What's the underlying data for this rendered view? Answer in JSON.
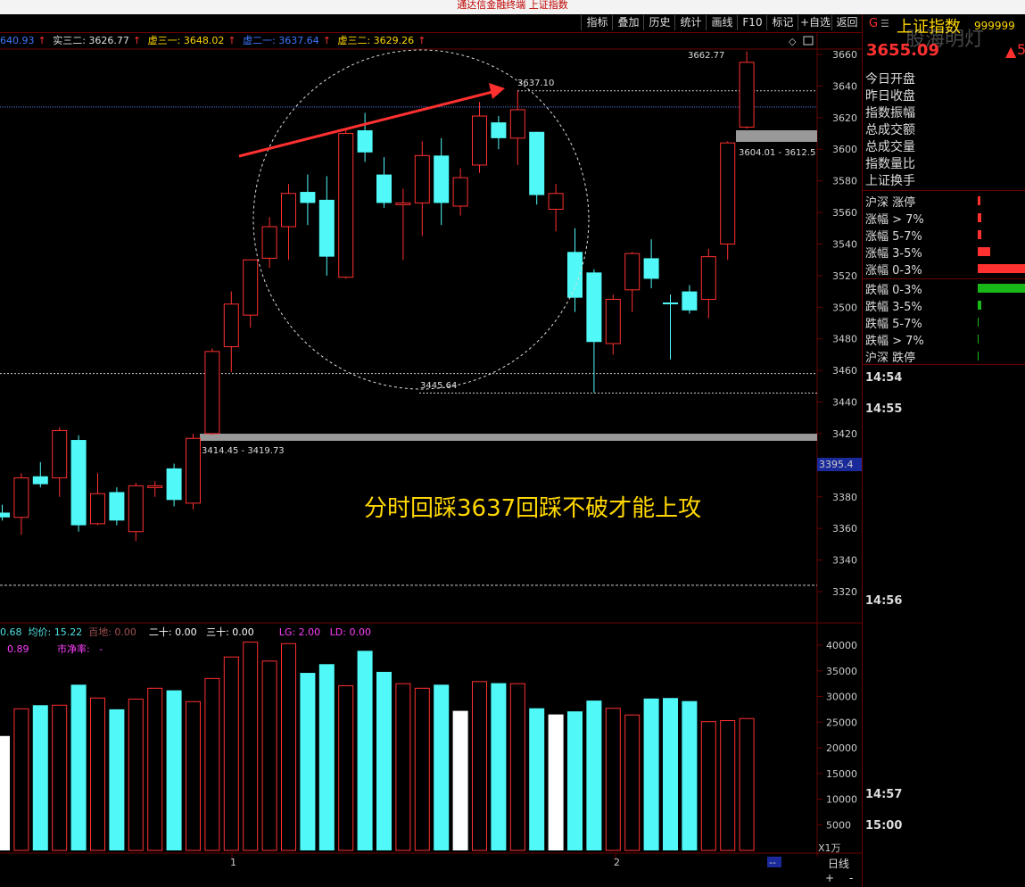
{
  "app_title": "通达信金融终端 上证指数",
  "toolbar": {
    "items": [
      "指标",
      "叠加",
      "历史",
      "统计",
      "画线",
      "F10",
      "标记",
      "+自选",
      "返回"
    ]
  },
  "info_bar": {
    "first": "640.93",
    "s1_label": "实三二: 3626.77",
    "s2_label": "虚三一: 3648.02",
    "s3_label": "虚二一: 3637.64",
    "s4_label": "虚三二: 3629.26"
  },
  "right_panel": {
    "g_label": "G",
    "menu_glyph": "☰",
    "title": "上证指数",
    "code": "999999",
    "watermark": "股海明灯",
    "price": "3655.09",
    "price_suffix": "5",
    "rows": [
      "今日开盘",
      "昨日收盘",
      "指数振幅",
      "总成交额",
      "总成交量",
      "指数量比",
      "上证换手"
    ],
    "breadth": [
      {
        "label": "沪深 涨停",
        "value": 0.05,
        "color": "#ff3030"
      },
      {
        "label": "涨幅 > 7%",
        "value": 0.07,
        "color": "#ff3030"
      },
      {
        "label": "涨幅 5-7%",
        "value": 0.08,
        "color": "#ff3030"
      },
      {
        "label": "涨幅 3-5%",
        "value": 0.25,
        "color": "#ff3030"
      },
      {
        "label": "涨幅 0-3%",
        "value": 1.0,
        "color": "#ff3030"
      },
      {
        "label": "跌幅 0-3%",
        "value": 1.0,
        "color": "#18b818"
      },
      {
        "label": "跌幅 3-5%",
        "value": 0.07,
        "color": "#18b818"
      },
      {
        "label": "跌幅 5-7%",
        "value": 0.02,
        "color": "#18b818"
      },
      {
        "label": "跌幅 > 7%",
        "value": 0.015,
        "color": "#18b818"
      },
      {
        "label": "沪深 跌停",
        "value": 0.01,
        "color": "#18b818"
      }
    ],
    "times": [
      "14:54",
      "14:55",
      "14:56",
      "14:57",
      "15:00"
    ]
  },
  "volume_bar": {
    "v1": "0.68",
    "avg": "均价: 15.22",
    "baidi": "百地: 0.00",
    "ershi": "二十: 0.00",
    "sanshi": "三十: 0.00",
    "lg": "LG: 2.00",
    "ld": "LD: 0.00",
    "row2_v": "0.89",
    "row2_label": "市净率:",
    "row2_val": "-"
  },
  "price_axis": {
    "ticks": [
      3660,
      3640,
      3620,
      3600,
      3580,
      3560,
      3540,
      3520,
      3500,
      3480,
      3460,
      3440,
      3420,
      3400,
      3380,
      3360,
      3340,
      3320
    ],
    "current": "3395.4"
  },
  "volume_axis": {
    "ticks": [
      40000,
      35000,
      30000,
      25000,
      20000,
      15000,
      10000,
      5000
    ],
    "unit": "X1万"
  },
  "time_axis": {
    "labels": [
      "1",
      "2"
    ],
    "tab": "日线",
    "plus": "+",
    "minus": "-",
    "dash": "--"
  },
  "annotations": {
    "high_label": "3662.77",
    "peak_label": "3637.10",
    "low_label": "3445.64",
    "support_label": "3414.45 - 3419.73",
    "resistance_label": "3604.01 - 3612.5",
    "comment": "分时回踩3637回踩不破才能上攻"
  },
  "candles": [
    {
      "o": 3370,
      "c": 3367,
      "h": 3375,
      "l": 3365,
      "col": "c"
    },
    {
      "o": 3367,
      "c": 3392,
      "h": 3395,
      "l": 3356,
      "col": "r"
    },
    {
      "o": 3388,
      "c": 3393,
      "h": 3402,
      "l": 3386,
      "col": "c"
    },
    {
      "o": 3392,
      "c": 3422,
      "h": 3424,
      "l": 3380,
      "col": "r"
    },
    {
      "o": 3416,
      "c": 3362,
      "h": 3419,
      "l": 3358,
      "col": "c"
    },
    {
      "o": 3363,
      "c": 3382,
      "h": 3395,
      "l": 3362,
      "col": "r"
    },
    {
      "o": 3383,
      "c": 3365,
      "h": 3386,
      "l": 3362,
      "col": "c"
    },
    {
      "o": 3358,
      "c": 3387,
      "h": 3389,
      "l": 3352,
      "col": "r"
    },
    {
      "o": 3387,
      "c": 3387,
      "h": 3390,
      "l": 3380,
      "col": "r"
    },
    {
      "o": 3398,
      "c": 3378,
      "h": 3401,
      "l": 3374,
      "col": "c"
    },
    {
      "o": 3376,
      "c": 3417,
      "h": 3420,
      "l": 3372,
      "col": "r"
    },
    {
      "o": 3420,
      "c": 3472,
      "h": 3474,
      "l": 3419,
      "col": "r"
    },
    {
      "o": 3475,
      "c": 3502,
      "h": 3510,
      "l": 3459,
      "col": "r"
    },
    {
      "o": 3495,
      "c": 3530,
      "h": 3530,
      "l": 3487,
      "col": "r"
    },
    {
      "o": 3531,
      "c": 3551,
      "h": 3557,
      "l": 3525,
      "col": "r"
    },
    {
      "o": 3551,
      "c": 3572,
      "h": 3578,
      "l": 3530,
      "col": "r"
    },
    {
      "o": 3573,
      "c": 3566,
      "h": 3584,
      "l": 3552,
      "col": "c"
    },
    {
      "o": 3568,
      "c": 3532,
      "h": 3583,
      "l": 3520,
      "col": "c"
    },
    {
      "o": 3519,
      "c": 3610,
      "h": 3613,
      "l": 3518,
      "col": "r"
    },
    {
      "o": 3612,
      "c": 3598,
      "h": 3623,
      "l": 3592,
      "col": "c"
    },
    {
      "o": 3584,
      "c": 3566,
      "h": 3595,
      "l": 3563,
      "col": "c"
    },
    {
      "o": 3566,
      "c": 3566,
      "h": 3575,
      "l": 3530,
      "col": "r"
    },
    {
      "o": 3566,
      "c": 3596,
      "h": 3605,
      "l": 3545,
      "col": "r"
    },
    {
      "o": 3596,
      "c": 3566,
      "h": 3607,
      "l": 3552,
      "col": "c"
    },
    {
      "o": 3564,
      "c": 3582,
      "h": 3588,
      "l": 3558,
      "col": "r"
    },
    {
      "o": 3590,
      "c": 3621,
      "h": 3630,
      "l": 3585,
      "col": "r"
    },
    {
      "o": 3617,
      "c": 3607,
      "h": 3621,
      "l": 3600,
      "col": "c"
    },
    {
      "o": 3607,
      "c": 3625,
      "h": 3637,
      "l": 3590,
      "col": "r"
    },
    {
      "o": 3611,
      "c": 3571,
      "h": 3611,
      "l": 3565,
      "col": "c"
    },
    {
      "o": 3562,
      "c": 3572,
      "h": 3578,
      "l": 3548,
      "col": "r"
    },
    {
      "o": 3535,
      "c": 3506,
      "h": 3550,
      "l": 3497,
      "col": "c"
    },
    {
      "o": 3522,
      "c": 3478,
      "h": 3524,
      "l": 3446,
      "col": "c"
    },
    {
      "o": 3477,
      "c": 3505,
      "h": 3508,
      "l": 3470,
      "col": "r"
    },
    {
      "o": 3511,
      "c": 3534,
      "h": 3535,
      "l": 3497,
      "col": "r"
    },
    {
      "o": 3531,
      "c": 3518,
      "h": 3543,
      "l": 3512,
      "col": "c"
    },
    {
      "o": 3503,
      "c": 3503,
      "h": 3508,
      "l": 3467,
      "col": "c"
    },
    {
      "o": 3510,
      "c": 3498,
      "h": 3514,
      "l": 3496,
      "col": "c"
    },
    {
      "o": 3505,
      "c": 3532,
      "h": 3537,
      "l": 3493,
      "col": "r"
    },
    {
      "o": 3540,
      "c": 3604,
      "h": 3605,
      "l": 3530,
      "col": "r"
    },
    {
      "o": 3614,
      "c": 3655,
      "h": 3662,
      "l": 3613,
      "col": "r"
    }
  ],
  "volumes": [
    {
      "v": 22300,
      "col": "w"
    },
    {
      "v": 27600,
      "col": "r"
    },
    {
      "v": 28300,
      "col": "c"
    },
    {
      "v": 28300,
      "col": "r"
    },
    {
      "v": 32300,
      "col": "c"
    },
    {
      "v": 29700,
      "col": "r"
    },
    {
      "v": 27500,
      "col": "c"
    },
    {
      "v": 29500,
      "col": "r"
    },
    {
      "v": 31600,
      "col": "r"
    },
    {
      "v": 31200,
      "col": "c"
    },
    {
      "v": 29000,
      "col": "r"
    },
    {
      "v": 33500,
      "col": "r"
    },
    {
      "v": 37700,
      "col": "r"
    },
    {
      "v": 40600,
      "col": "r"
    },
    {
      "v": 36900,
      "col": "r"
    },
    {
      "v": 40300,
      "col": "r"
    },
    {
      "v": 34600,
      "col": "c"
    },
    {
      "v": 36300,
      "col": "c"
    },
    {
      "v": 32100,
      "col": "r"
    },
    {
      "v": 38900,
      "col": "c"
    },
    {
      "v": 34800,
      "col": "c"
    },
    {
      "v": 32500,
      "col": "r"
    },
    {
      "v": 31600,
      "col": "r"
    },
    {
      "v": 32300,
      "col": "c"
    },
    {
      "v": 27200,
      "col": "w"
    },
    {
      "v": 32900,
      "col": "r"
    },
    {
      "v": 32600,
      "col": "c"
    },
    {
      "v": 32500,
      "col": "r"
    },
    {
      "v": 27700,
      "col": "c"
    },
    {
      "v": 26500,
      "col": "w"
    },
    {
      "v": 27100,
      "col": "c"
    },
    {
      "v": 29200,
      "col": "c"
    },
    {
      "v": 27700,
      "col": "r"
    },
    {
      "v": 26400,
      "col": "r"
    },
    {
      "v": 29600,
      "col": "c"
    },
    {
      "v": 29700,
      "col": "c"
    },
    {
      "v": 29100,
      "col": "c"
    },
    {
      "v": 25100,
      "col": "r"
    },
    {
      "v": 25300,
      "col": "r"
    },
    {
      "v": 25700,
      "col": "r"
    }
  ]
}
